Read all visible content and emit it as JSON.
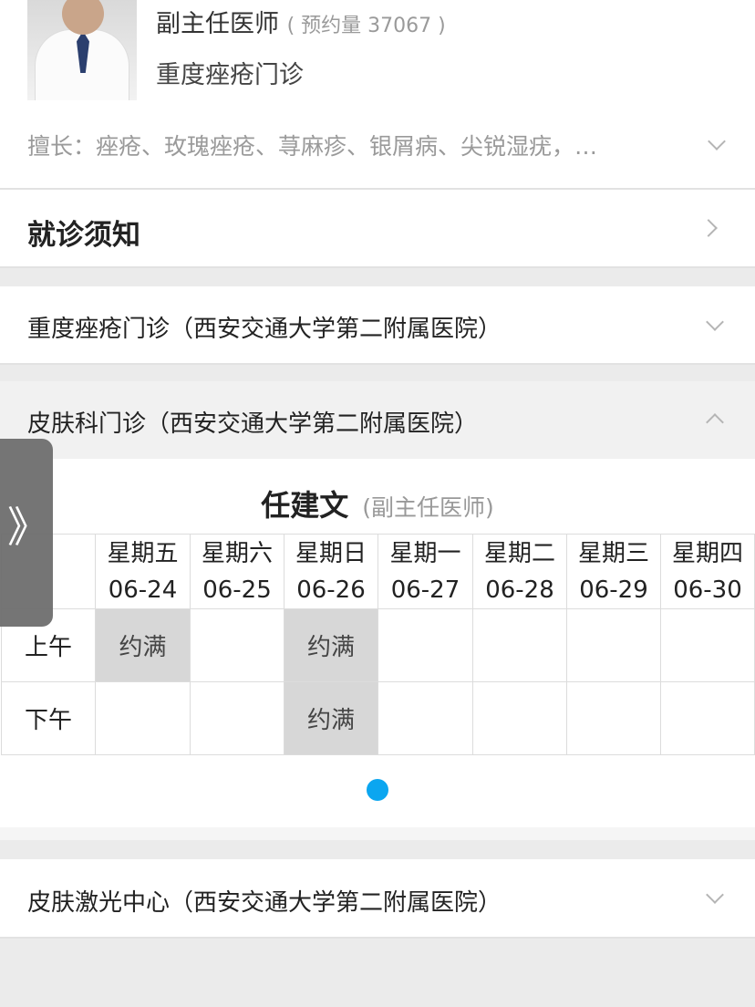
{
  "doctor": {
    "title": "副主任医师",
    "appointment_count": "( 预约量 37067 )",
    "clinic": "重度痤疮门诊",
    "specialty": "擅长：痤疮、玫瑰痤疮、荨麻疹、银屑病、尖锐湿疣，…"
  },
  "notice": {
    "label": "就诊须知"
  },
  "departments": [
    {
      "label": "重度痤疮门诊（西安交通大学第二附属医院）",
      "expanded": false
    },
    {
      "label": "皮肤科门诊（西安交通大学第二附属医院）",
      "expanded": true
    },
    {
      "label": "皮肤激光中心（西安交通大学第二附属医院）",
      "expanded": false
    }
  ],
  "schedule": {
    "doctor_name": "任建文",
    "doctor_rank": "(副主任医师)",
    "days": [
      {
        "weekday": "星期五",
        "date": "06-24"
      },
      {
        "weekday": "星期六",
        "date": "06-25"
      },
      {
        "weekday": "星期日",
        "date": "06-26"
      },
      {
        "weekday": "星期一",
        "date": "06-27"
      },
      {
        "weekday": "星期二",
        "date": "06-28"
      },
      {
        "weekday": "星期三",
        "date": "06-29"
      },
      {
        "weekday": "星期四",
        "date": "06-30"
      }
    ],
    "periods": [
      {
        "label": "上午",
        "slots": [
          "约满",
          "",
          "约满",
          "",
          "",
          "",
          ""
        ]
      },
      {
        "label": "下午",
        "slots": [
          "",
          "",
          "约满",
          "",
          "",
          "",
          ""
        ]
      }
    ],
    "page_indicator": {
      "current": 1,
      "total": 1,
      "color": "#0ba6f0"
    }
  },
  "side_handle": {
    "glyph": "》"
  }
}
